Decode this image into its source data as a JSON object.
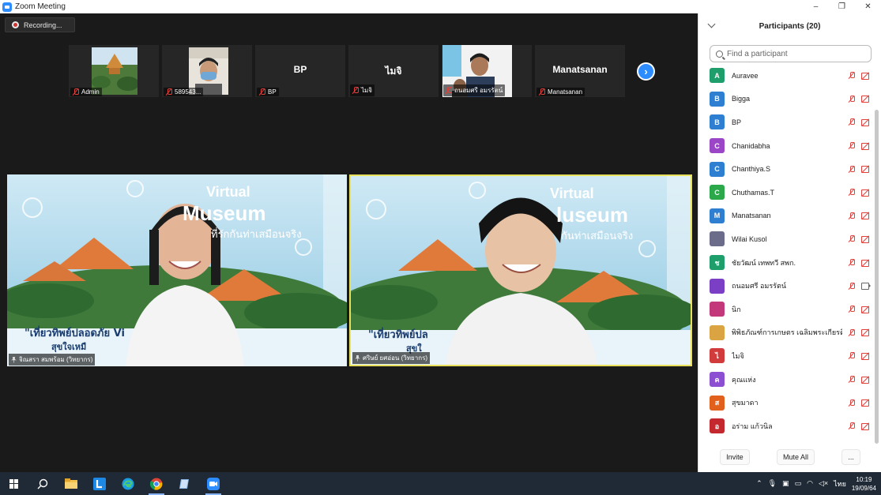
{
  "window": {
    "title": "Zoom Meeting",
    "controls": [
      "–",
      "❐",
      "✕"
    ]
  },
  "recording": {
    "label": "Recording..."
  },
  "strip": {
    "tiles": [
      {
        "name": "Admin",
        "kind": "image"
      },
      {
        "name": "589543...",
        "kind": "image"
      },
      {
        "name": "BP",
        "kind": "text",
        "big": "BP"
      },
      {
        "name": "ไมจิ",
        "kind": "text",
        "big": "ไมจิ"
      },
      {
        "name": "ถนอมศรี อมรรัตน์",
        "kind": "image"
      },
      {
        "name": "Manatsanan",
        "kind": "text",
        "big": "Manatsanan"
      }
    ],
    "next_icon": "chevron-right-icon"
  },
  "videos": [
    {
      "name": "จิณสรา สมพร้อม (วิทยากร)",
      "bg_title": "Virtual",
      "bg_subtitle": "Museum",
      "bg_tagline": "ที่รักกันท่าเสมือนจริง",
      "bg_bottom": "\"เที่ยวทิพย์ปลอดภัย Vi",
      "bg_bottom2": "สุขใจเหมื"
    },
    {
      "name": "ศริษย์ ยศอ่อน (วิทยากร)",
      "bg_title": "Virtual",
      "bg_subtitle": "luseum",
      "bg_tagline": "กันท่าเสมือนจริง",
      "bg_bottom": "\"เที่ยวทิพย์ปล",
      "bg_bottom2": "สุขใ"
    }
  ],
  "panel": {
    "title": "Participants (20)",
    "search_placeholder": "Find a participant",
    "participants": [
      {
        "initial": "A",
        "name": "Auravee",
        "color": "#1e9e6a",
        "cam": "off"
      },
      {
        "initial": "B",
        "name": "Bigga",
        "color": "#2e7fd1",
        "cam": "off"
      },
      {
        "initial": "B",
        "name": "BP",
        "color": "#2e7fd1",
        "cam": "off"
      },
      {
        "initial": "C",
        "name": "Chanidabha",
        "color": "#9b46c7",
        "cam": "off"
      },
      {
        "initial": "C",
        "name": "Chanthiya.S",
        "color": "#2e7fd1",
        "cam": "off"
      },
      {
        "initial": "C",
        "name": "Chuthamas.T",
        "color": "#2aa84a",
        "cam": "off"
      },
      {
        "initial": "M",
        "name": "Manatsanan",
        "color": "#2e7fd1",
        "cam": "off"
      },
      {
        "initial": "",
        "name": "Wilai Kusol",
        "color": "#6b6b8a",
        "cam": "off"
      },
      {
        "initial": "ช",
        "name": "ชัยวัฒน์ เทพทวี สพก.",
        "color": "#1e9e6a",
        "cam": "off"
      },
      {
        "initial": "",
        "name": "ถนอมศรี อมรรัตน์",
        "color": "#7a3fc4",
        "cam": "on"
      },
      {
        "initial": "",
        "name": "นิก",
        "color": "#c2387a",
        "cam": "off"
      },
      {
        "initial": "",
        "name": "พิพิธภัณฑ์การเกษตร เฉลิมพระเกียรติฯ",
        "color": "#d9a441",
        "cam": "off"
      },
      {
        "initial": "ไ",
        "name": "ไมจิ",
        "color": "#d23b3b",
        "cam": "off"
      },
      {
        "initial": "ค",
        "name": "คุณแห่ง",
        "color": "#8c4fd1",
        "cam": "off"
      },
      {
        "initial": "ส",
        "name": "สุขมาดา",
        "color": "#e0601c",
        "cam": "off"
      },
      {
        "initial": "อ",
        "name": "อร่าม แก้วนิล",
        "color": "#c4282f",
        "cam": "off"
      }
    ],
    "footer": {
      "invite": "Invite",
      "mute_all": "Mute All",
      "more": "..."
    }
  },
  "taskbar": {
    "apps": [
      "start-icon",
      "search-icon",
      "file-explorer-icon",
      "l-app-icon",
      "edge-icon",
      "chrome-icon",
      "notes-icon",
      "zoom-icon"
    ],
    "lang": "ไทย",
    "time": "10:19",
    "date": "19/09/64"
  }
}
